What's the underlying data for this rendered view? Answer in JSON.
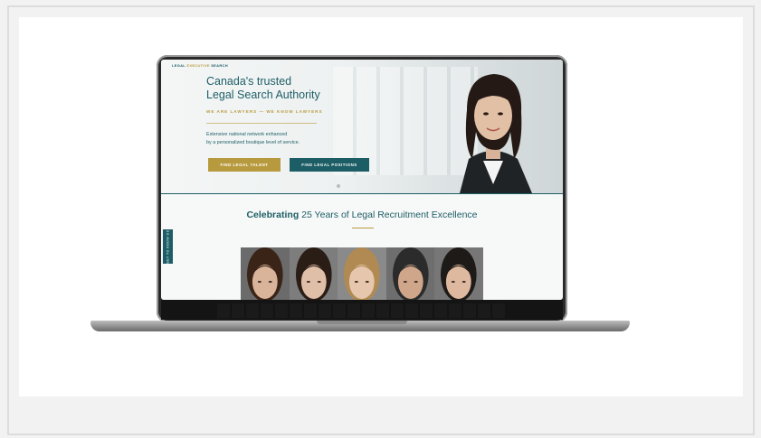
{
  "site": {
    "logo": {
      "part1": "LEGAL",
      "part2": "EXECUTIVE",
      "part3": "SEARCH"
    },
    "hero": {
      "title_line1": "Canada's trusted",
      "title_line2": "Legal Search Authority",
      "tagline": "WE ARE LAWYERS — WE KNOW LAWYERS",
      "subtitle_line1": "Extensive national network enhanced",
      "subtitle_line2": "by a personalized boutique level of service.",
      "btn_talent": "FIND LEGAL TALENT",
      "btn_positions": "FIND LEGAL POSITIONS"
    },
    "celebrating": {
      "bold": "Celebrating",
      "rest": " 25 Years of Legal Recruitment Excellence"
    },
    "side_tab": "GET TO KNOW US"
  },
  "colors": {
    "teal": "#1d5e66",
    "gold": "#b89a3e"
  },
  "faces": [
    {
      "hair": "#3a2418",
      "skin": "#d9b39a",
      "bg": "#6b6b6b"
    },
    {
      "hair": "#2a1d16",
      "skin": "#e0bfa8",
      "bg": "#7d7d7d"
    },
    {
      "hair": "#b08a52",
      "skin": "#e6c7ad",
      "bg": "#8a8a8a"
    },
    {
      "hair": "#2b2b2b",
      "skin": "#cfa68a",
      "bg": "#6e6e6e"
    },
    {
      "hair": "#1e1a18",
      "skin": "#deb9a0",
      "bg": "#777777"
    }
  ]
}
